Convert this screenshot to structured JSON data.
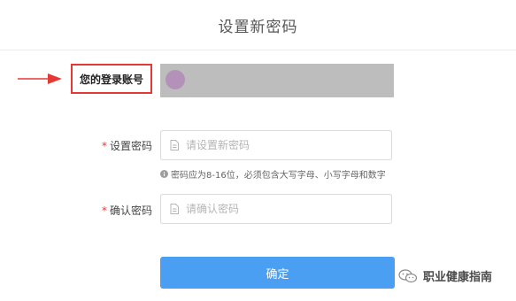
{
  "page": {
    "title": "设置新密码"
  },
  "account": {
    "label": "您的登录账号",
    "value": ""
  },
  "new_password": {
    "required_mark": "*",
    "label": "设置密码",
    "placeholder": "请设置新密码",
    "value": "",
    "icon": "document-icon"
  },
  "hint": {
    "icon": "info-icon",
    "text": "密码应为8-16位，必须包含大写字母、小写字母和数字"
  },
  "confirm_password": {
    "required_mark": "*",
    "label": "确认密码",
    "placeholder": "请确认密码",
    "value": "",
    "icon": "document-icon"
  },
  "actions": {
    "confirm_label": "确定"
  },
  "watermark": {
    "icon": "wechat-icon",
    "text": "职业健康指南"
  },
  "colors": {
    "primary": "#4b9ff2",
    "highlight_border": "#e53935",
    "arrow": "#e53935",
    "redacted": "#bdbdbd"
  }
}
